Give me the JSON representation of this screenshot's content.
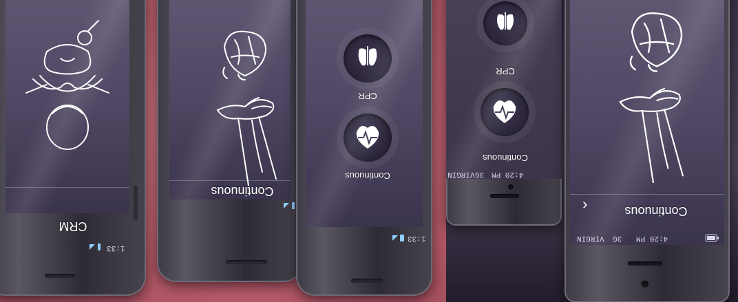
{
  "phones": {
    "phone1": {
      "screen_label": "CRM",
      "status_time": "1:33"
    },
    "phone2": {
      "screen_label": "Continuous"
    },
    "phone3": {
      "menu_label_1": "CPR",
      "menu_label_2": "Continuous",
      "status_time": "1:33"
    },
    "phone4": {
      "menu_label_1": "CPR",
      "menu_label_2": "Continuous",
      "carrier": "VIRGIN",
      "network": "3G",
      "status_time": "4:20 PM"
    },
    "phone5": {
      "screen_label": "Continuous",
      "back_glyph": "‹",
      "carrier": "VIRGIN",
      "network": "3G",
      "status_time": "4:20 PM"
    }
  },
  "colors": {
    "left_background": "#c46472",
    "right_background": "#3a3248",
    "screen_purple": "#4f4763"
  },
  "icons": [
    "infant-head-icon",
    "heart-anatomy-icon",
    "cpr-hands-icon",
    "lungs-icon",
    "heart-pulse-icon",
    "signal-icon",
    "battery-icon"
  ]
}
